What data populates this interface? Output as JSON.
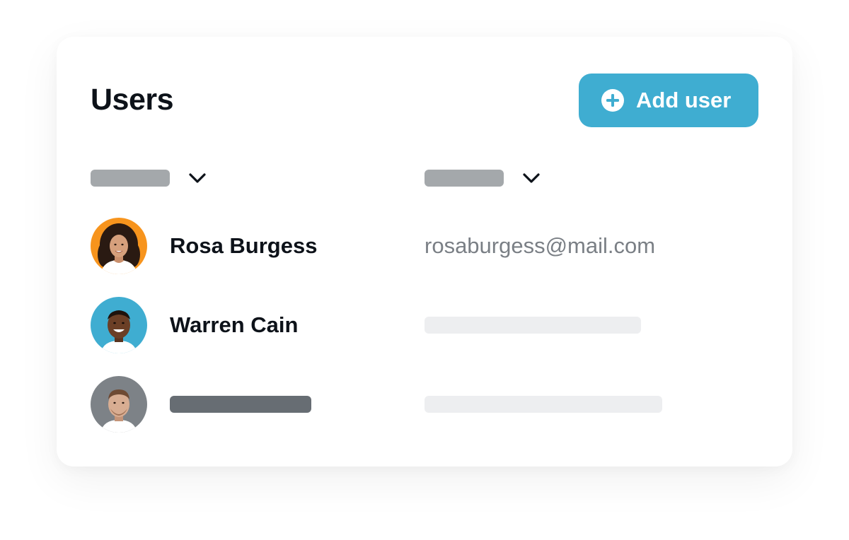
{
  "page": {
    "title": "Users"
  },
  "toolbar": {
    "add_user_label": "Add user",
    "accent_color": "#3fadd1"
  },
  "table": {
    "columns": [
      {
        "label": "",
        "sort_icon": "chevron-down-icon"
      },
      {
        "label": "",
        "sort_icon": "chevron-down-icon"
      }
    ],
    "rows": [
      {
        "name": "Rosa Burgess",
        "email": "rosaburgess@mail.com",
        "avatar_bg": "#f7941d"
      },
      {
        "name": "Warren Cain",
        "email": "",
        "avatar_bg": "#3fadd1"
      },
      {
        "name": "",
        "email": "",
        "avatar_bg": "#7d8287"
      }
    ]
  }
}
